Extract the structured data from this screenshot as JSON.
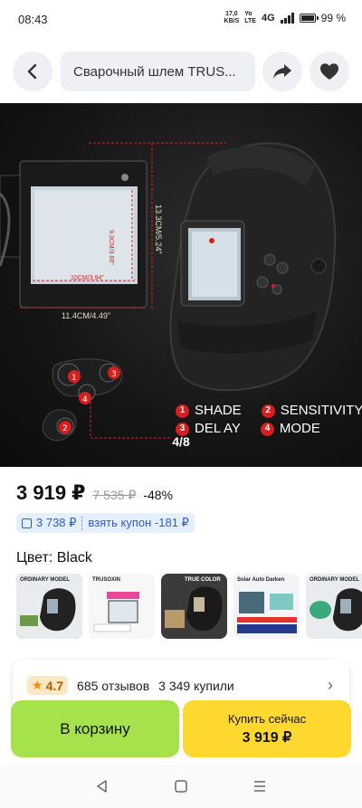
{
  "status": {
    "time": "08:43",
    "speed_value": "17,0",
    "speed_unit": "KB/S",
    "volte_top": "Yo",
    "volte_bottom": "LTE",
    "network": "4G",
    "battery": "99 %",
    "battery_level": 0.99
  },
  "header": {
    "title": "Сварочный шлем TRUS...",
    "back_icon": "chevron-left-icon",
    "share_icon": "share-arrow-icon",
    "favorite_icon": "heart-icon"
  },
  "gallery": {
    "counter": "4/8",
    "dim_width": "10CM/3.94\"",
    "dim_height": "9.3CM/3.66\"",
    "dim_outer_width": "11.4CM/4.49\"",
    "dim_outer_height": "13.3CM/5.24\"",
    "legend": [
      {
        "num": "1",
        "label": "SHADE"
      },
      {
        "num": "2",
        "label": "SENSITIVITY"
      },
      {
        "num": "3",
        "label": "DEL AY"
      },
      {
        "num": "4",
        "label": "MODE"
      }
    ],
    "accent": "#d61f1f"
  },
  "price": {
    "current": "3 919 ₽",
    "old": "7 535 ₽",
    "discount": "-48%"
  },
  "coupon": {
    "price": "3 738 ₽",
    "label": "взять купон -181 ₽"
  },
  "color": {
    "label": "Цвет: Black"
  },
  "thumbs": [
    {
      "text": "ORDINARY MODEL"
    },
    {
      "text": "TRUSOXIN"
    },
    {
      "text": "TRUE COLOR"
    },
    {
      "text": "Solar Auto Darken"
    },
    {
      "text": "ORDINARY MODEL"
    }
  ],
  "rating": {
    "score": "4.7",
    "reviews": "685 отзывов",
    "bought": "3 349 купили"
  },
  "actions": {
    "cart": "В корзину",
    "buy_label": "Купить сейчас",
    "buy_price": "3 919 ₽",
    "cart_color": "#a6e24b",
    "buy_color": "#fed82e"
  },
  "navbar": {
    "back_icon": "triangle-back-icon",
    "home_icon": "square-home-icon",
    "menu_icon": "menu-lines-icon"
  }
}
